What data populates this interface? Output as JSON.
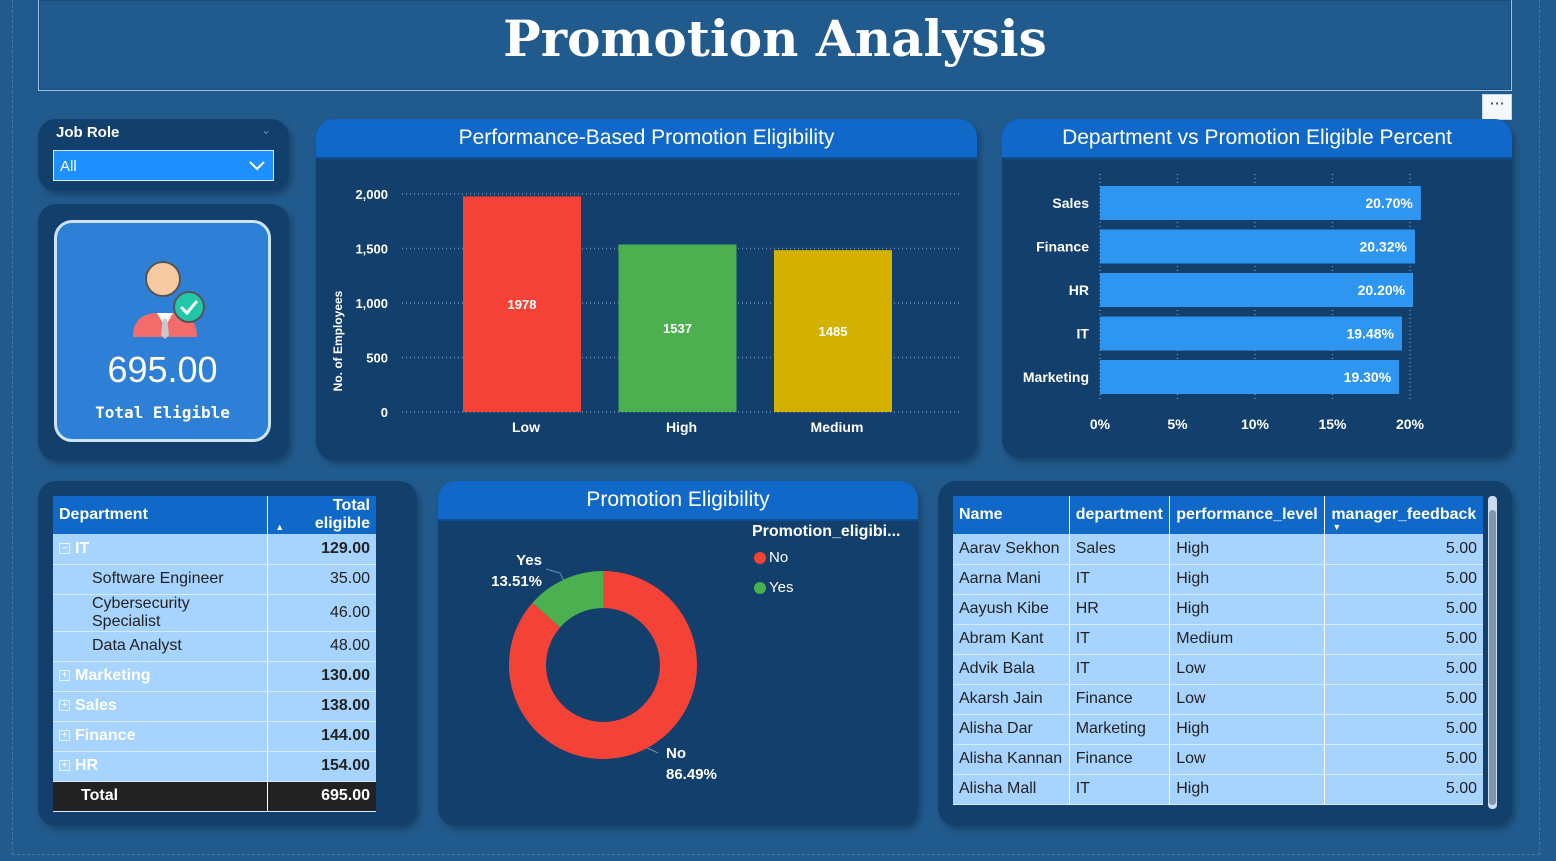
{
  "title": "Promotion Analysis",
  "slicer": {
    "label": "Job Role",
    "value": "All"
  },
  "kpi": {
    "value": "695.00",
    "label": "Total Eligible"
  },
  "bar_chart": {
    "title": "Performance-Based Promotion Eligibility",
    "ylabel": "No. of Employees",
    "yticks": [
      "2,000",
      "1,500",
      "1,000",
      "500",
      "0"
    ]
  },
  "hbar_chart": {
    "title": "Department vs Promotion Eligible Percent",
    "xticks": [
      "0%",
      "5%",
      "10%",
      "15%",
      "20%"
    ]
  },
  "donut": {
    "title": "Promotion Eligibility",
    "legend_title": "Promotion_eligibi...",
    "legend": [
      {
        "label": "No",
        "color": "#f44336"
      },
      {
        "label": "Yes",
        "color": "#4caf50"
      }
    ],
    "label_yes_name": "Yes",
    "label_yes_pct": "13.51%",
    "label_no_name": "No",
    "label_no_pct": "86.49%"
  },
  "chart_data": [
    {
      "type": "bar",
      "title": "Performance-Based Promotion Eligibility",
      "ylabel": "No. of Employees",
      "xlabel": "",
      "categories": [
        "Low",
        "High",
        "Medium"
      ],
      "values": [
        1978,
        1537,
        1485
      ],
      "colors": [
        "#f44336",
        "#4caf50",
        "#d4b000"
      ],
      "ylim": [
        0,
        2000
      ],
      "grid": true
    },
    {
      "type": "bar",
      "orientation": "horizontal",
      "title": "Department vs Promotion Eligible Percent",
      "categories": [
        "Sales",
        "Finance",
        "HR",
        "IT",
        "Marketing"
      ],
      "values": [
        20.7,
        20.32,
        20.2,
        19.48,
        19.3
      ],
      "labels": [
        "20.70%",
        "20.32%",
        "20.20%",
        "19.48%",
        "19.30%"
      ],
      "xlim": [
        0,
        20
      ],
      "color": "#2e95f0",
      "grid": true
    },
    {
      "type": "pie",
      "style": "donut",
      "title": "Promotion Eligibility",
      "categories": [
        "No",
        "Yes"
      ],
      "values": [
        86.49,
        13.51
      ],
      "colors": [
        "#f44336",
        "#4caf50"
      ],
      "legend": "top-right"
    }
  ],
  "dept_table": {
    "headers": [
      "Department",
      "Total eligible"
    ],
    "rows": [
      {
        "label": "IT",
        "value": "129.00",
        "group": true,
        "expanded": true
      },
      {
        "label": "Software Engineer",
        "value": "35.00",
        "group": false
      },
      {
        "label": "Cybersecurity Specialist",
        "value": "46.00",
        "group": false
      },
      {
        "label": "Data Analyst",
        "value": "48.00",
        "group": false
      },
      {
        "label": "Marketing",
        "value": "130.00",
        "group": true,
        "expanded": false
      },
      {
        "label": "Sales",
        "value": "138.00",
        "group": true,
        "expanded": false
      },
      {
        "label": "Finance",
        "value": "144.00",
        "group": true,
        "expanded": false
      },
      {
        "label": "HR",
        "value": "154.00",
        "group": true,
        "expanded": false
      }
    ],
    "total": {
      "label": "Total",
      "value": "695.00"
    }
  },
  "emp_table": {
    "headers": [
      "Name",
      "department",
      "performance_level",
      "manager_feedback"
    ],
    "rows": [
      [
        "Aarav Sekhon",
        "Sales",
        "High",
        "5.00"
      ],
      [
        "Aarna Mani",
        "IT",
        "High",
        "5.00"
      ],
      [
        "Aayush Kibe",
        "HR",
        "High",
        "5.00"
      ],
      [
        "Abram Kant",
        "IT",
        "Medium",
        "5.00"
      ],
      [
        "Advik Bala",
        "IT",
        "Low",
        "5.00"
      ],
      [
        "Akarsh Jain",
        "Finance",
        "Low",
        "5.00"
      ],
      [
        "Alisha Dar",
        "Marketing",
        "High",
        "5.00"
      ],
      [
        "Alisha Kannan",
        "Finance",
        "Low",
        "5.00"
      ],
      [
        "Alisha Mall",
        "IT",
        "High",
        "5.00"
      ]
    ]
  },
  "more_options": "···"
}
